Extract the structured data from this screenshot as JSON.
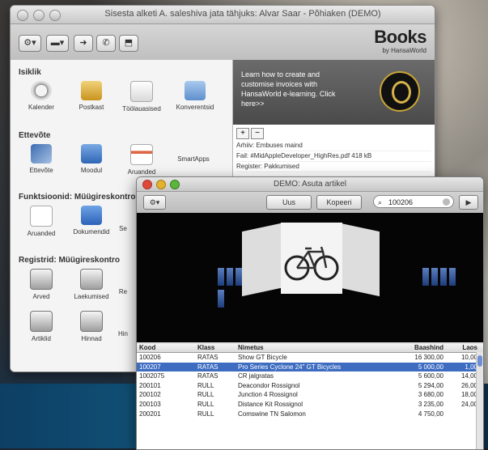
{
  "main_window": {
    "title": "Sisesta alketi A. saleshiva jata tähjuks: Alvar Saar - Põhiaken (DEMO)",
    "brand": {
      "name": "Books",
      "tagline": "by HansaWorld"
    },
    "toolbar": {
      "action_label": "⚙▾",
      "list_label": "▬▾",
      "forward_label": "➜",
      "phone_label": "✆",
      "inbox_label": "⬒"
    },
    "sections": [
      {
        "title": "Isiklik",
        "items": [
          "Kalender",
          "Postkast",
          "Töölauasised",
          "Konverentsid"
        ]
      },
      {
        "title": "Ettevõte",
        "items": [
          "Ettevõte",
          "Moodul",
          "Aruanded",
          "SmartApps"
        ]
      },
      {
        "title": "Funktsioonid: Müügireskontro",
        "items": [
          "Aruanded",
          "Dokumendid",
          "Se"
        ]
      },
      {
        "title": "Registrid: Müügireskontro",
        "items": [
          "Arved",
          "Laekumised",
          "Re",
          "Artiklid",
          "Hinnad",
          "Hin"
        ]
      }
    ],
    "promo": {
      "text": "Learn how to create and customise invoices with HansaWorld e-learning. Click here>>"
    },
    "files": [
      "Arhiiv: Embuses maind",
      "Fail: #MidAppleDeveloper_HighRes.pdf   418 kB",
      "Register: Pakkumised"
    ]
  },
  "dialog": {
    "title": "DEMO: Asuta artikel",
    "buttons": {
      "action": "⚙▾",
      "uus": "Uus",
      "kopeeri": "Kopeeri",
      "next": "▶"
    },
    "search_value": "100206",
    "table": {
      "headers": [
        "Kood",
        "Klass",
        "Nimetus",
        "Baashind",
        "Laos"
      ],
      "rows": [
        [
          "100206",
          "RATAS",
          "Show GT Bicycle",
          "16 300,00",
          "10,00"
        ],
        [
          "100207",
          "RATAS",
          "Pro Series Cyclone 24\" GT Bicycles",
          "5 000,00",
          "1,00"
        ],
        [
          "1002075",
          "RATAS",
          "CR jalgratas",
          "5 600,00",
          "14,00"
        ],
        [
          "200101",
          "RULL",
          "Deacondor Rossignol",
          "5 294,00",
          "26,00"
        ],
        [
          "200102",
          "RULL",
          "Junction 4 Rossignol",
          "3 680,00",
          "18,00"
        ],
        [
          "200103",
          "RULL",
          "Distance Kit Rossignol",
          "3 235,00",
          "24,00"
        ],
        [
          "200201",
          "RULL",
          "Comswine TN Salomon",
          "4 750,00",
          ""
        ]
      ],
      "selected_row": 1
    }
  }
}
